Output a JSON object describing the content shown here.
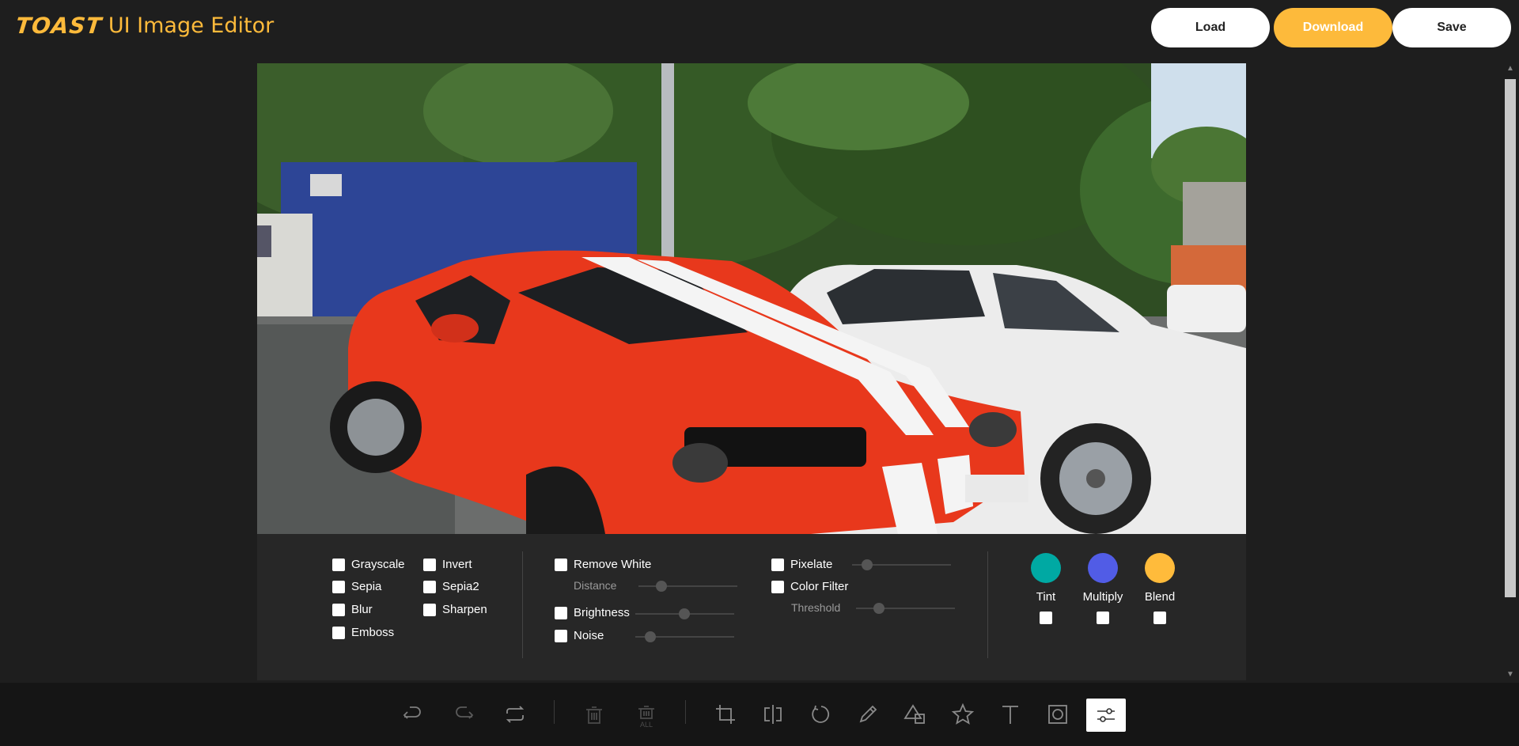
{
  "header": {
    "logo_brand": "TOAST",
    "logo_sub": "UI Image Editor",
    "load_label": "Load",
    "download_label": "Download",
    "save_label": "Save"
  },
  "filters": {
    "basic": [
      {
        "label": "Grayscale"
      },
      {
        "label": "Invert"
      },
      {
        "label": "Sepia"
      },
      {
        "label": "Sepia2"
      },
      {
        "label": "Blur"
      },
      {
        "label": "Sharpen"
      },
      {
        "label": "Emboss"
      }
    ],
    "remove_white_label": "Remove White",
    "distance_label": "Distance",
    "brightness_label": "Brightness",
    "noise_label": "Noise",
    "pixelate_label": "Pixelate",
    "color_filter_label": "Color Filter",
    "threshold_label": "Threshold",
    "tint_label": "Tint",
    "multiply_label": "Multiply",
    "blend_label": "Blend"
  },
  "colors": {
    "accent": "#fdba3b",
    "tint": "#00a9a3",
    "multiply": "#515ce6",
    "blend": "#ffbb3b"
  },
  "toolbar": {
    "icons": [
      "undo-icon",
      "redo-icon",
      "reset-icon",
      "delete-icon",
      "delete-all-icon",
      "crop-icon",
      "flip-icon",
      "rotate-icon",
      "draw-icon",
      "shape-icon",
      "icon-icon",
      "text-icon",
      "mask-icon",
      "filter-icon"
    ],
    "delete_all_text": "ALL",
    "active": "filter-icon"
  }
}
